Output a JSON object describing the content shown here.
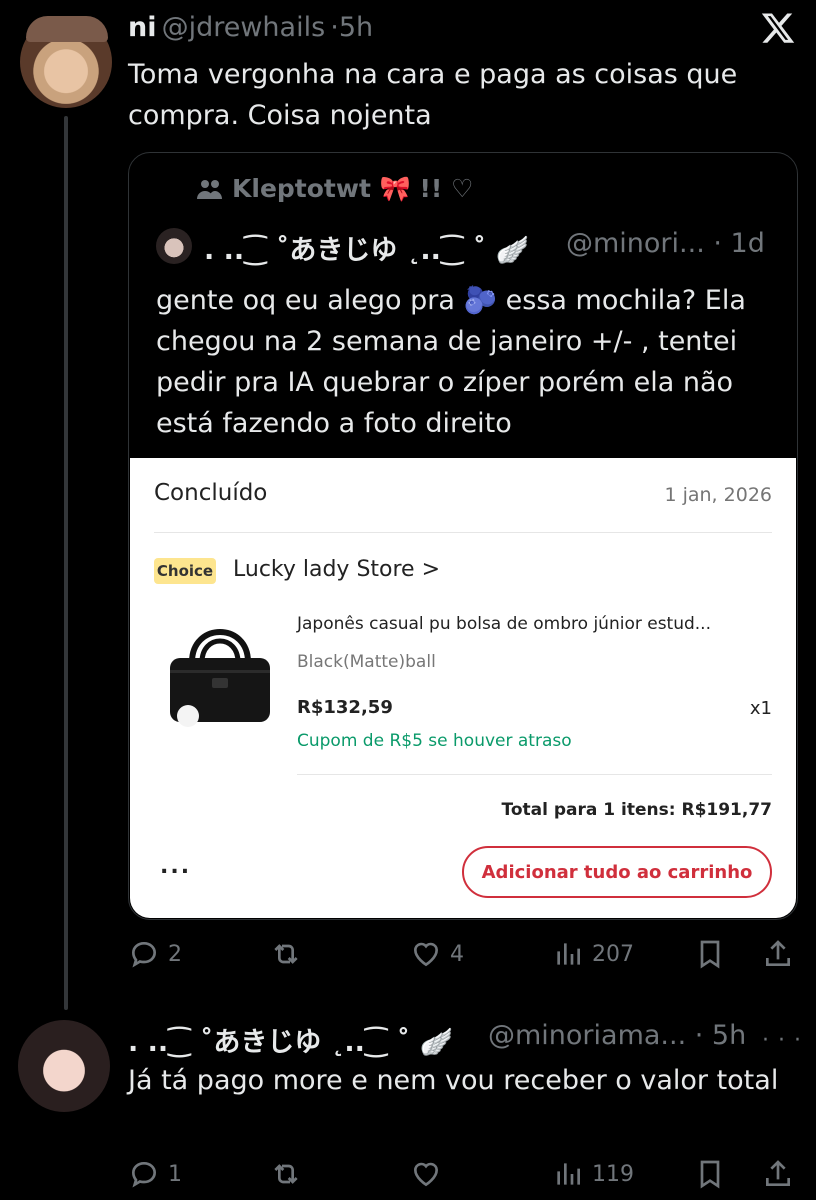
{
  "tweet": {
    "name": "ni",
    "handle": "@jdrewhails",
    "time": "5h",
    "text": "Toma vergonha na cara e paga as coisas que compra. Coisa nojenta",
    "actions": {
      "replies": "2",
      "likes": "4",
      "views": "207"
    }
  },
  "quote": {
    "community": "Kleptotwt 🎀 !! ♡",
    "name": ". ..⁐ ˚あきじゆ ˛..⁐ ˚ 🪽",
    "handle": "@minori... · 1d",
    "text": "gente oq eu alego pra 🫐 essa mochila? Ela chegou na 2 semana de janeiro +/- , tentei pedir pra IA quebrar o zíper porém ela não está fazendo a foto direito"
  },
  "order": {
    "status": "Concluído",
    "date": "1 jan, 2026",
    "badge": "Choice",
    "store": "Lucky lady Store >",
    "product_title": "Japonês casual pu bolsa de ombro júnior estud...",
    "variant": "Black(Matte)ball",
    "price": "R$132,59",
    "qty": "x1",
    "coupon": "Cupom de R$5 se houver atraso",
    "total": "Total para 1 itens: R$191,77",
    "more": "...",
    "cart_button": "Adicionar tudo ao carrinho"
  },
  "reply": {
    "name": ". ..⁐ ˚あきじゆ ˛..⁐ ˚ 🪽",
    "handle": "@minoriama... · 5h",
    "more": "· · ·",
    "text": "Já tá pago more e nem vou receber o valor total",
    "actions": {
      "replies": "1",
      "views": "119"
    }
  },
  "icons": [
    "x-logo-icon",
    "community-icon",
    "reply-icon",
    "retweet-icon",
    "like-icon",
    "views-icon",
    "bookmark-icon",
    "share-icon"
  ],
  "colors": {
    "background": "#000000",
    "text": "#e7e9ea",
    "muted": "#71767b",
    "border": "#2f3336",
    "accent_red": "#d02f3c",
    "coupon_green": "#0a9a6a",
    "choice_yellow": "#fde58f"
  }
}
